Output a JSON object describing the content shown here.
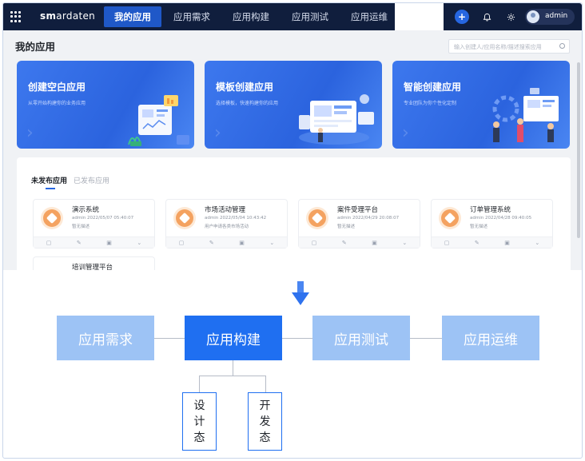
{
  "topnav": {
    "brand_prefix": "sm",
    "brand_rest": "ardaten",
    "items": [
      {
        "label": "我的应用",
        "active": true
      },
      {
        "label": "应用需求",
        "active": false
      },
      {
        "label": "应用构建",
        "active": false
      },
      {
        "label": "应用测试",
        "active": false
      },
      {
        "label": "应用运维",
        "active": false
      }
    ],
    "plus_symbol": "+",
    "user": "admin"
  },
  "page": {
    "title": "我的应用",
    "search_placeholder": "输入创建人/应用名称/描述搜索应用"
  },
  "create_cards": [
    {
      "title": "创建空白应用",
      "desc": "从零开始构建你的业务应用"
    },
    {
      "title": "模板创建应用",
      "desc": "选择模板，快速构建你的应用"
    },
    {
      "title": "智能创建应用",
      "desc": "专业团队为你个性化定制"
    }
  ],
  "tabs": [
    {
      "label": "未发布应用",
      "active": true
    },
    {
      "label": "已发布应用",
      "active": false
    }
  ],
  "apps": [
    {
      "name": "演示系统",
      "meta": "admin 2022/05/07 05:40:07",
      "desc": "暂无描述"
    },
    {
      "name": "市场活动管理",
      "meta": "admin 2022/05/04 10:43:42",
      "desc": "用户申请各类市场活动"
    },
    {
      "name": "案件受理平台",
      "meta": "admin 2022/04/29 20:08:07",
      "desc": "暂无描述"
    },
    {
      "name": "订单管理系统",
      "meta": "admin 2022/04/28 09:40:05",
      "desc": "暂无描述"
    },
    {
      "name": "培训管理平台",
      "meta": "",
      "desc": ""
    }
  ],
  "flow": {
    "stages": [
      {
        "label": "应用需求",
        "active": false
      },
      {
        "label": "应用构建",
        "active": true
      },
      {
        "label": "应用测试",
        "active": false
      },
      {
        "label": "应用运维",
        "active": false
      }
    ],
    "sub_stages": [
      {
        "chars": [
          "设",
          "计",
          "态"
        ]
      },
      {
        "chars": [
          "开",
          "发",
          "态"
        ]
      }
    ]
  },
  "colors": {
    "nav_dark": "#101e3d",
    "nav_active": "#1f58c8",
    "card_blue": "#2b63de",
    "stage_light": "#9dc3f5",
    "stage_active": "#1f6ff1"
  }
}
